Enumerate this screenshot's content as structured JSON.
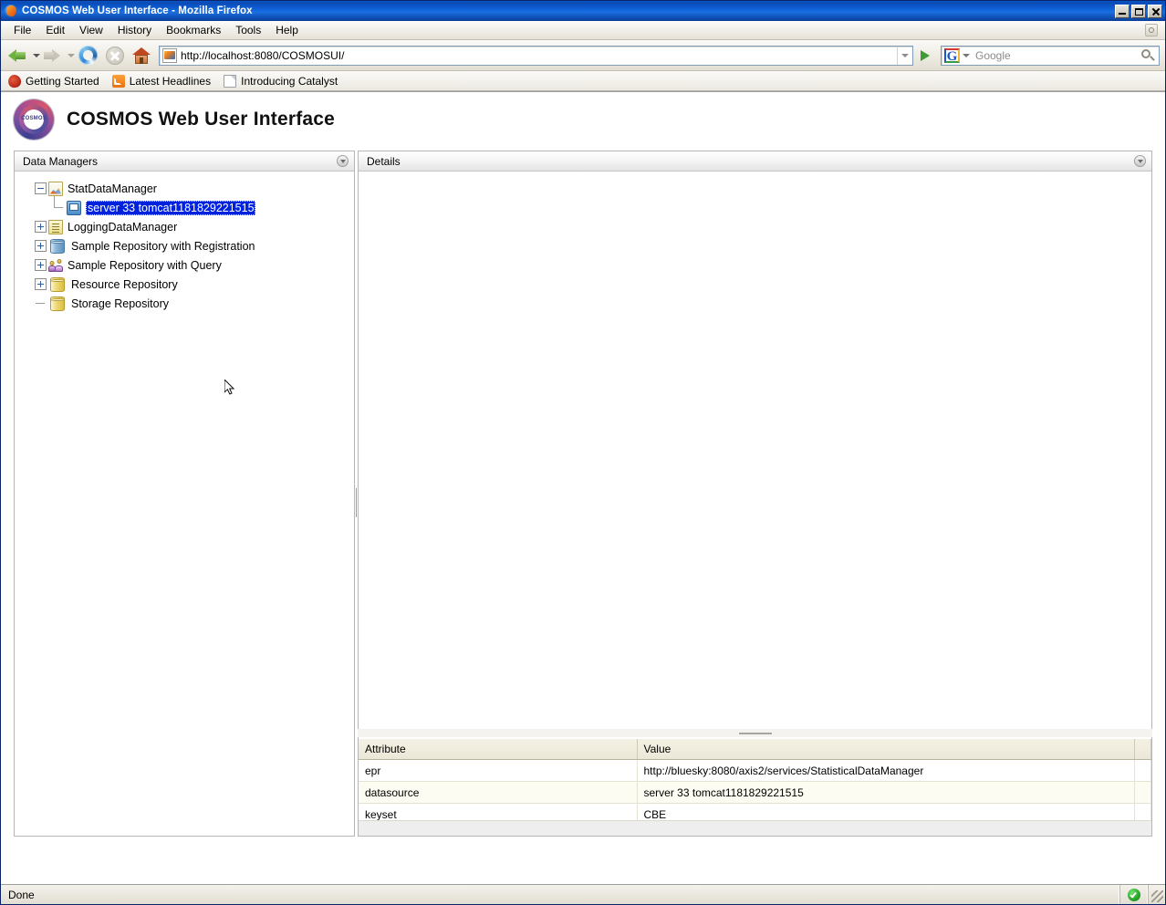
{
  "window": {
    "title": "COSMOS Web User Interface - Mozilla Firefox",
    "minimize_label": "Minimize",
    "maximize_label": "Maximize",
    "close_label": "Close"
  },
  "menubar": {
    "items": [
      {
        "label": "File"
      },
      {
        "label": "Edit"
      },
      {
        "label": "View"
      },
      {
        "label": "History"
      },
      {
        "label": "Bookmarks"
      },
      {
        "label": "Tools"
      },
      {
        "label": "Help"
      }
    ]
  },
  "toolbar": {
    "back_label": "Back",
    "forward_label": "Forward",
    "reload_label": "Reload",
    "stop_label": "Stop",
    "home_label": "Home",
    "url_value": "http://localhost:8080/COSMOSUI/",
    "go_label": "Go",
    "search_engine": "Google",
    "search_placeholder": "Google",
    "search_value": ""
  },
  "bookmarks": {
    "items": [
      {
        "label": "Getting Started",
        "icon": "bookmark-red-icon"
      },
      {
        "label": "Latest Headlines",
        "icon": "rss-icon"
      },
      {
        "label": "Introducing Catalyst",
        "icon": "document-icon"
      }
    ]
  },
  "app": {
    "title": "COSMOS Web User Interface",
    "logo_text": "COSMOS"
  },
  "panels": {
    "data_managers": {
      "title": "Data Managers",
      "menu_icon": "chevron-down-circle-icon"
    },
    "details": {
      "title": "Details",
      "menu_icon": "chevron-down-circle-icon"
    }
  },
  "tree": {
    "nodes": [
      {
        "label": "StatDataManager",
        "icon": "stat-chart-icon",
        "expander": "minus",
        "level": 0,
        "selected": false
      },
      {
        "label": "server 33 tomcat1181829221515",
        "icon": "monitor-icon",
        "expander": "leaf-elbow",
        "level": 1,
        "selected": true
      },
      {
        "label": "LoggingDataManager",
        "icon": "log-document-icon",
        "expander": "plus",
        "level": 0,
        "selected": false
      },
      {
        "label": "Sample Repository with Registration",
        "icon": "database-blue-icon",
        "expander": "plus",
        "level": 0,
        "selected": false
      },
      {
        "label": "Sample Repository with Query",
        "icon": "users-icon",
        "expander": "plus",
        "level": 0,
        "selected": false
      },
      {
        "label": "Resource Repository",
        "icon": "cylinder-yellow-icon",
        "expander": "plus",
        "level": 0,
        "selected": false
      },
      {
        "label": "Storage Repository",
        "icon": "cylinder-yellow-icon",
        "expander": "dash",
        "level": 0,
        "selected": false
      }
    ]
  },
  "attributes_table": {
    "columns": [
      "Attribute",
      "Value"
    ],
    "rows": [
      {
        "attribute": "epr",
        "value": "http://bluesky:8080/axis2/services/StatisticalDataManager"
      },
      {
        "attribute": "datasource",
        "value": "server 33 tomcat1181829221515"
      },
      {
        "attribute": "keyset",
        "value": "CBE"
      }
    ]
  },
  "statusbar": {
    "text": "Done",
    "secure_icon": "green-check-icon",
    "resize_grip": "resize-grip-icon"
  },
  "colors": {
    "titlebar_blue": "#0f62d8",
    "selection_blue": "#0022dd",
    "table_header_beige": "#ece8d8",
    "status_green": "#28a428"
  }
}
